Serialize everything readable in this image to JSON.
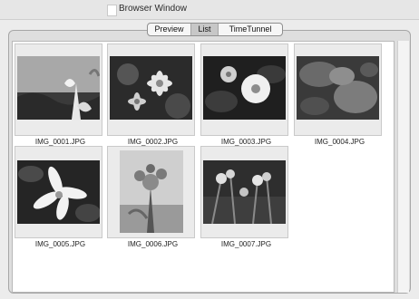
{
  "window": {
    "title": "Browser Window"
  },
  "view_switcher": {
    "segments": [
      {
        "label": "Preview",
        "selected": false
      },
      {
        "label": "List",
        "selected": true
      },
      {
        "label": "TimeTunnel",
        "selected": false
      }
    ]
  },
  "images": [
    {
      "name": "IMG_0001.JPG",
      "icon": "photo-thumbnail"
    },
    {
      "name": "IMG_0002.JPG",
      "icon": "photo-thumbnail"
    },
    {
      "name": "IMG_0003.JPG",
      "icon": "photo-thumbnail"
    },
    {
      "name": "IMG_0004.JPG",
      "icon": "photo-thumbnail"
    },
    {
      "name": "IMG_0005.JPG",
      "icon": "photo-thumbnail"
    },
    {
      "name": "IMG_0006.JPG",
      "icon": "photo-thumbnail"
    },
    {
      "name": "IMG_0007.JPG",
      "icon": "photo-thumbnail"
    }
  ],
  "colors": {
    "selected_segment": "#c7c7c7",
    "panel": "#dedede",
    "content_bg": "#ffffff"
  }
}
